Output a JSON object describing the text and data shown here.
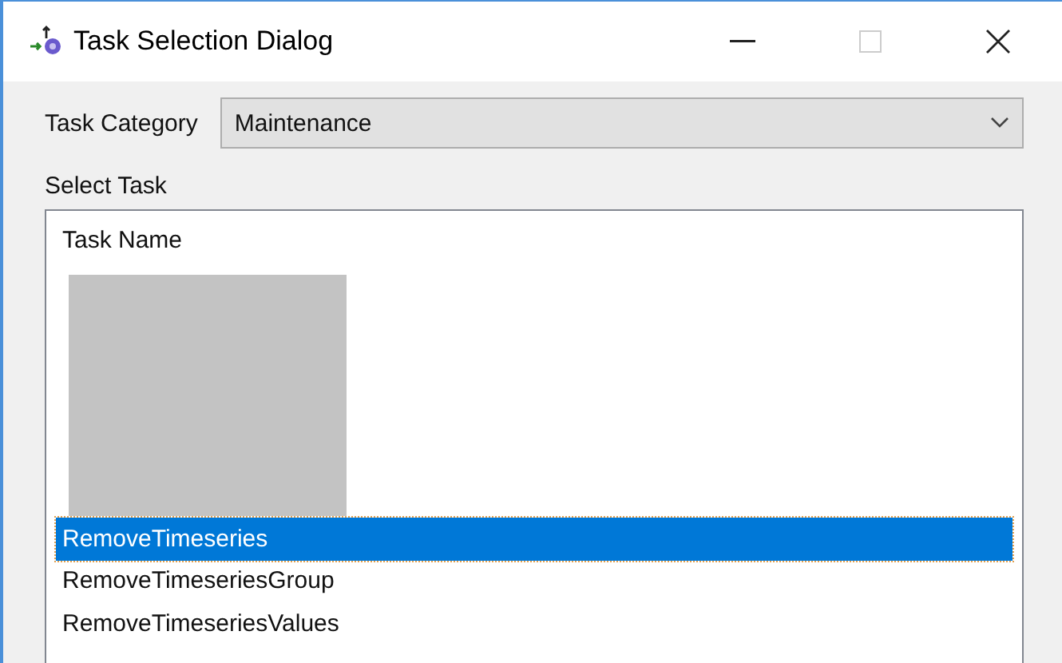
{
  "window": {
    "title": "Task Selection Dialog"
  },
  "task_category": {
    "label": "Task Category",
    "value": "Maintenance"
  },
  "select_task": {
    "label": "Select Task",
    "column": "Task Name",
    "rows": [
      {
        "kind": "redacted",
        "selected": false
      },
      {
        "kind": "redacted",
        "selected": false
      },
      {
        "kind": "redacted",
        "selected": false
      },
      {
        "kind": "redacted",
        "selected": false
      },
      {
        "kind": "redacted",
        "selected": false
      },
      {
        "kind": "redacted",
        "selected": false
      },
      {
        "kind": "task",
        "name": "RemoveTimeseries",
        "selected": true
      },
      {
        "kind": "task",
        "name": "RemoveTimeseriesGroup",
        "selected": false
      },
      {
        "kind": "task",
        "name": "RemoveTimeseriesValues",
        "selected": false
      }
    ]
  }
}
